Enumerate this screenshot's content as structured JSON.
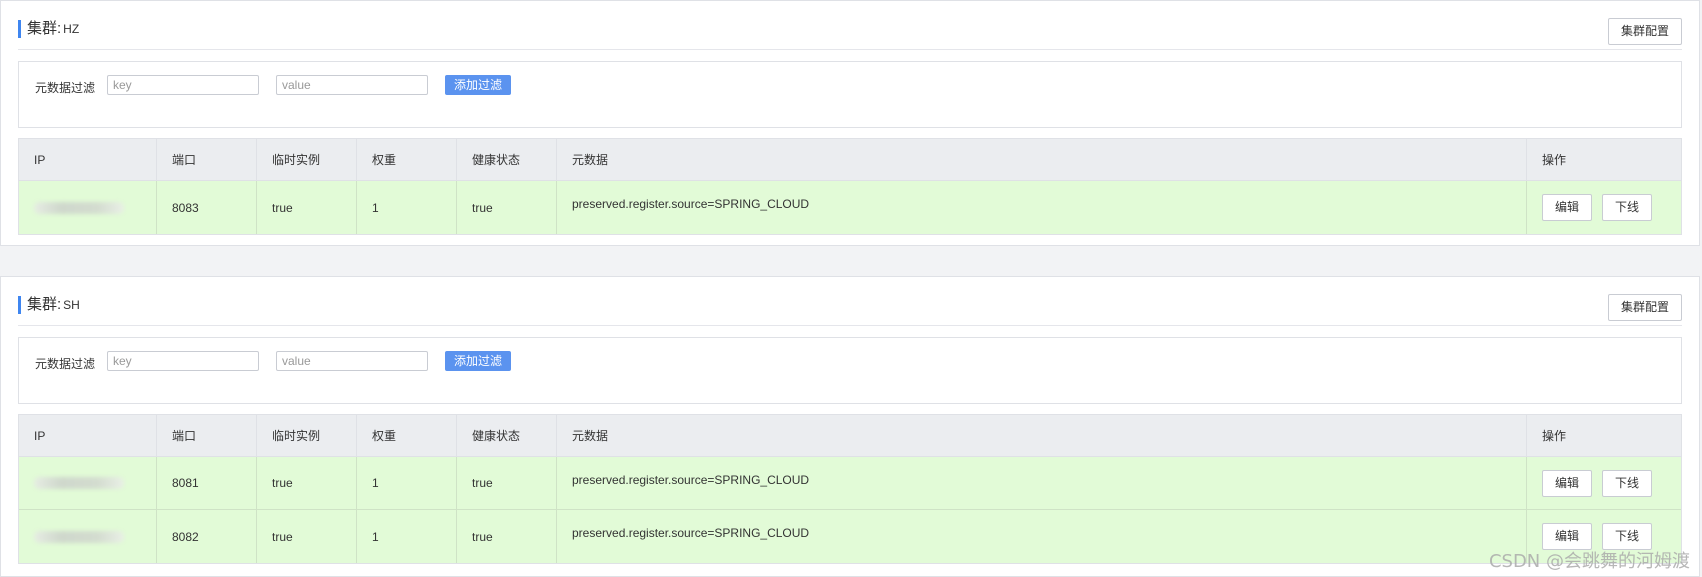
{
  "clusters": [
    {
      "title_prefix": "集群:",
      "name": "HZ",
      "config_label": "集群配置",
      "filter": {
        "label": "元数据过滤",
        "key_placeholder": "key",
        "value_placeholder": "value",
        "add_label": "添加过滤"
      },
      "table": {
        "headers": [
          "IP",
          "端口",
          "临时实例",
          "权重",
          "健康状态",
          "元数据",
          "操作"
        ],
        "rows": [
          {
            "ip": "",
            "port": "8083",
            "ephemeral": "true",
            "weight": "1",
            "healthy": "true",
            "metadata": "preserved.register.source=SPRING_CLOUD",
            "edit_label": "编辑",
            "offline_label": "下线"
          }
        ]
      }
    },
    {
      "title_prefix": "集群:",
      "name": "SH",
      "config_label": "集群配置",
      "filter": {
        "label": "元数据过滤",
        "key_placeholder": "key",
        "value_placeholder": "value",
        "add_label": "添加过滤"
      },
      "table": {
        "headers": [
          "IP",
          "端口",
          "临时实例",
          "权重",
          "健康状态",
          "元数据",
          "操作"
        ],
        "rows": [
          {
            "ip": "",
            "port": "8081",
            "ephemeral": "true",
            "weight": "1",
            "healthy": "true",
            "metadata": "preserved.register.source=SPRING_CLOUD",
            "edit_label": "编辑",
            "offline_label": "下线"
          },
          {
            "ip": "",
            "port": "8082",
            "ephemeral": "true",
            "weight": "1",
            "healthy": "true",
            "metadata": "preserved.register.source=SPRING_CLOUD",
            "edit_label": "编辑",
            "offline_label": "下线"
          }
        ]
      }
    }
  ],
  "watermark": "CSDN @会跳舞的河姆渡",
  "colors": {
    "accent": "#3f86f0",
    "add_button": "#5b93ef",
    "row_bg": "#e2fbd7",
    "header_bg": "#ebedf0"
  }
}
